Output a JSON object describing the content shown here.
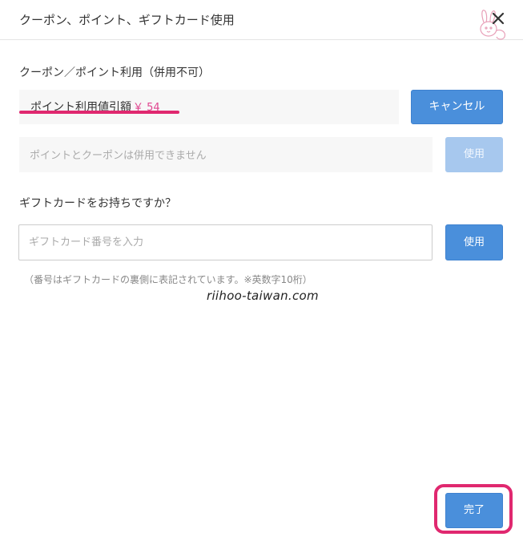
{
  "header": {
    "title": "クーポン、ポイント、ギフトカード使用",
    "close_icon": "close-icon",
    "watermark_icon": "rabbit-logo-icon"
  },
  "coupon_section": {
    "label": "クーポン／ポイント利用（併用不可）",
    "discount_label": "ポイント利用値引額",
    "discount_amount": "￥ 54",
    "cancel_button": "キャンセル",
    "code_field_text": "ポイントとクーポンは併用できません",
    "use_button": "使用",
    "use_button_enabled": false
  },
  "gift_section": {
    "label": "ギフトカードをお持ちですか？",
    "input_placeholder": "ギフトカード番号を入力",
    "input_value": "",
    "use_button": "使用",
    "note": "（番号はギフトカードの裏側に表記されています。※英数字10桁）"
  },
  "watermark": {
    "site": "riihoo-taiwan.com"
  },
  "footer": {
    "done_button": "完了"
  },
  "colors": {
    "primary_button": "#4a8fdb",
    "disabled_button": "#a7c8ee",
    "highlight_mark": "#e0286f",
    "discount_amount": "#e0458f"
  }
}
